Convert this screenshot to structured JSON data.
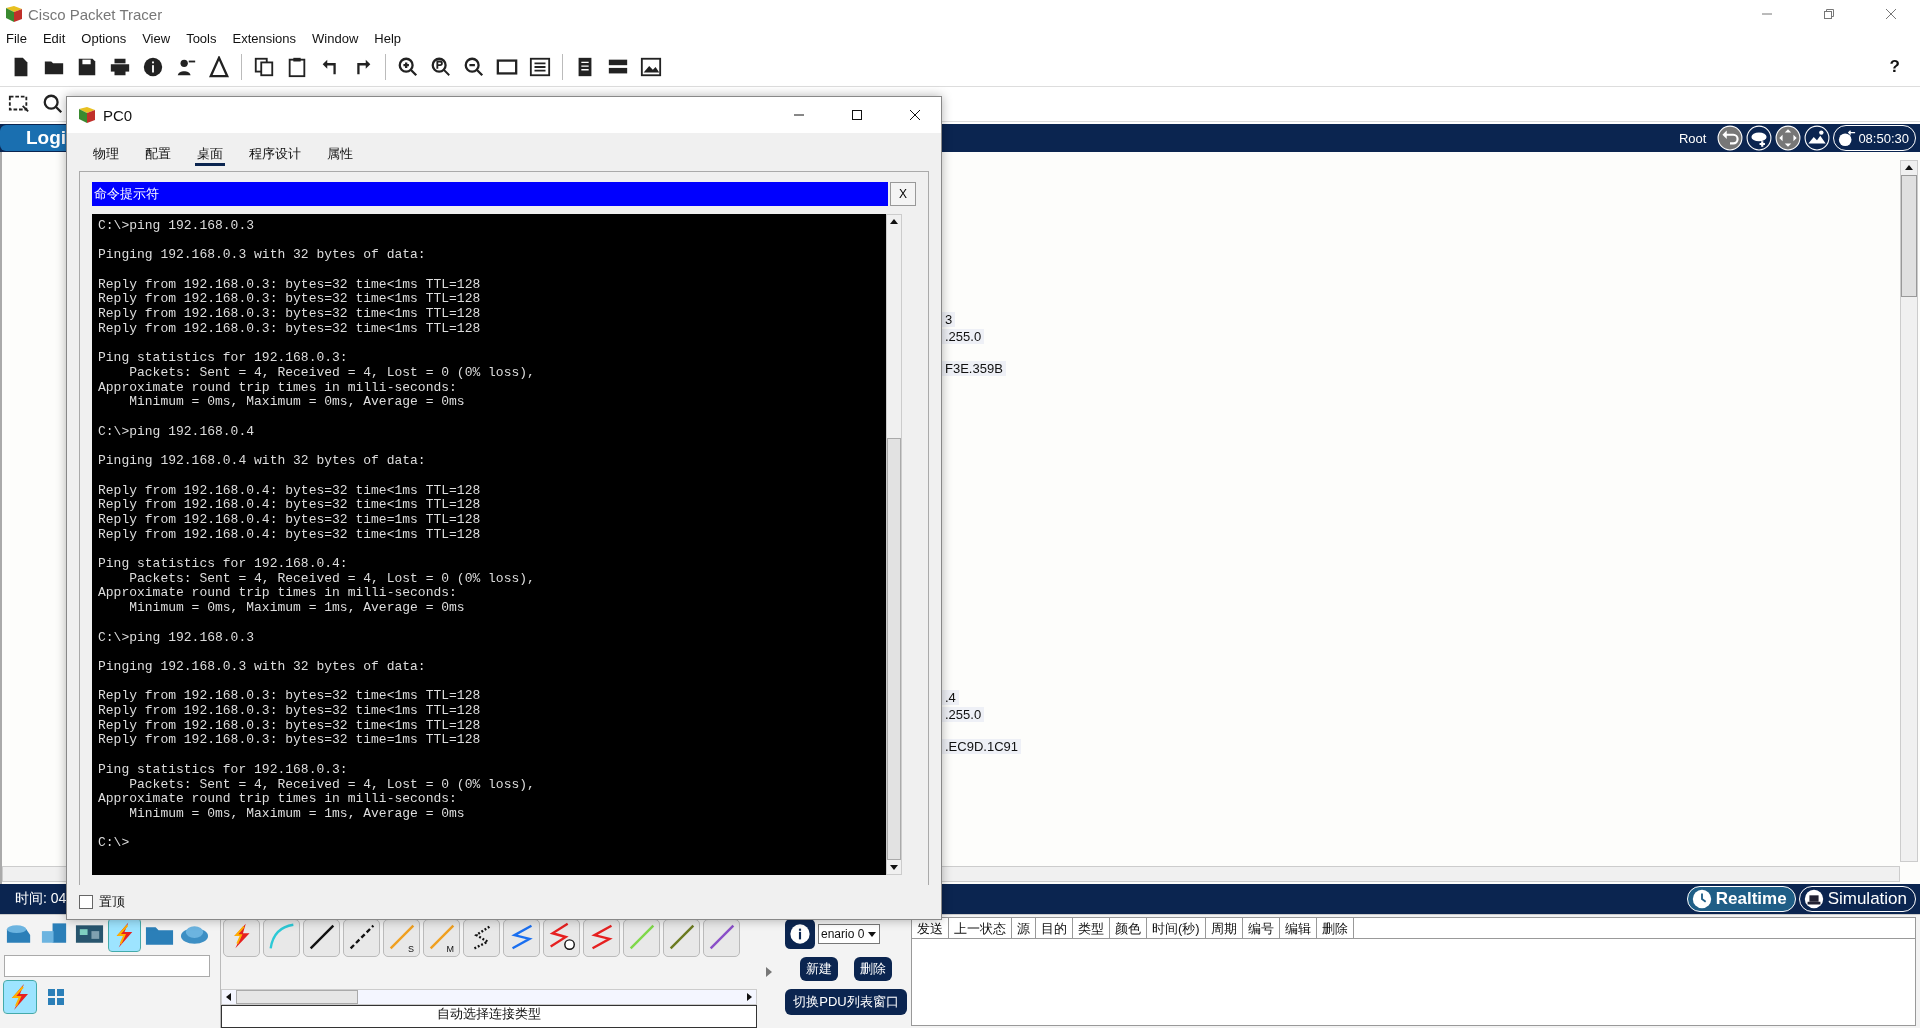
{
  "app": {
    "title": "Cisco Packet Tracer",
    "menu": [
      "File",
      "Edit",
      "Options",
      "View",
      "Tools",
      "Extensions",
      "Window",
      "Help"
    ],
    "help": "?"
  },
  "logical_bar": {
    "tab": "Logi",
    "user": "Root",
    "clock": "08:50:30"
  },
  "workspace": {
    "device_labels": [
      {
        "lines": [
          "3",
          ".255.0",
          "F3E.359B"
        ]
      },
      {
        "lines": [
          ".4",
          ".255.0",
          ".EC9D.1C91"
        ]
      }
    ]
  },
  "status_bar": {
    "time": "时间: 04",
    "modes": [
      {
        "label": "Realtime",
        "kind": "clock",
        "selected": true
      },
      {
        "label": "Simulation",
        "kind": "runner",
        "selected": false
      }
    ]
  },
  "bottom": {
    "device_categories": [
      {
        "kind": "router",
        "selected": false
      },
      {
        "kind": "computer",
        "selected": false
      },
      {
        "kind": "board",
        "selected": false
      },
      {
        "kind": "connection",
        "selected": true
      },
      {
        "kind": "folder",
        "selected": false
      },
      {
        "kind": "cloud",
        "selected": false
      }
    ],
    "sub_categories": [
      {
        "kind": "connection",
        "selected": true
      },
      {
        "kind": "grid",
        "selected": false
      }
    ],
    "connections": [
      {
        "kind": "auto"
      },
      {
        "kind": "console"
      },
      {
        "kind": "straight"
      },
      {
        "kind": "crossover"
      },
      {
        "kind": "fiber",
        "label": "S"
      },
      {
        "kind": "fiber",
        "label": "M"
      },
      {
        "kind": "phone"
      },
      {
        "kind": "coaxial"
      },
      {
        "kind": "serial-dce"
      },
      {
        "kind": "serial-dte"
      },
      {
        "kind": "octal"
      },
      {
        "kind": "iot"
      },
      {
        "kind": "usb"
      }
    ],
    "connection_caption": "自动选择连接类型",
    "scenario": {
      "value": "enario 0",
      "buttons": [
        "新建",
        "删除"
      ],
      "toggle": "切换PDU列表窗口"
    },
    "pdu_columns": [
      "发送",
      "上一状态",
      "源",
      "目的",
      "类型",
      "颜色",
      "时间(秒)",
      "周期",
      "编号",
      "编辑",
      "删除"
    ]
  },
  "dialog": {
    "title": "PC0",
    "tabs": [
      {
        "label": "物理",
        "selected": false
      },
      {
        "label": "配置",
        "selected": false
      },
      {
        "label": "桌面",
        "selected": true
      },
      {
        "label": "程序设计",
        "selected": false
      },
      {
        "label": "属性",
        "selected": false
      }
    ],
    "app_title": "命令提示符",
    "app_close": "X",
    "terminal": [
      [
        "C:\\>ping 192.168.0.3"
      ],
      [
        "Pinging 192.168.0.3 with 32 bytes of data:"
      ],
      [
        "Reply from 192.168.0.3: bytes=32 time<1ms TTL=128",
        "Reply from 192.168.0.3: bytes=32 time<1ms TTL=128",
        "Reply from 192.168.0.3: bytes=32 time<1ms TTL=128",
        "Reply from 192.168.0.3: bytes=32 time<1ms TTL=128"
      ],
      [
        "Ping statistics for 192.168.0.3:",
        "    Packets: Sent = 4, Received = 4, Lost = 0 (0% loss),",
        "Approximate round trip times in milli-seconds:",
        "    Minimum = 0ms, Maximum = 0ms, Average = 0ms"
      ],
      [
        "C:\\>ping 192.168.0.4"
      ],
      [
        "Pinging 192.168.0.4 with 32 bytes of data:"
      ],
      [
        "Reply from 192.168.0.4: bytes=32 time<1ms TTL=128",
        "Reply from 192.168.0.4: bytes=32 time<1ms TTL=128",
        "Reply from 192.168.0.4: bytes=32 time=1ms TTL=128",
        "Reply from 192.168.0.4: bytes=32 time<1ms TTL=128"
      ],
      [
        "Ping statistics for 192.168.0.4:",
        "    Packets: Sent = 4, Received = 4, Lost = 0 (0% loss),",
        "Approximate round trip times in milli-seconds:",
        "    Minimum = 0ms, Maximum = 1ms, Average = 0ms"
      ],
      [
        "C:\\>ping 192.168.0.3"
      ],
      [
        "Pinging 192.168.0.3 with 32 bytes of data:"
      ],
      [
        "Reply from 192.168.0.3: bytes=32 time<1ms TTL=128",
        "Reply from 192.168.0.3: bytes=32 time<1ms TTL=128",
        "Reply from 192.168.0.3: bytes=32 time<1ms TTL=128",
        "Reply from 192.168.0.3: bytes=32 time=1ms TTL=128"
      ],
      [
        "Ping statistics for 192.168.0.3:",
        "    Packets: Sent = 4, Received = 4, Lost = 0 (0% loss),",
        "Approximate round trip times in milli-seconds:",
        "    Minimum = 0ms, Maximum = 1ms, Average = 0ms"
      ],
      [
        "C:\\>"
      ]
    ],
    "pin": {
      "label": "置顶",
      "checked": false
    }
  }
}
